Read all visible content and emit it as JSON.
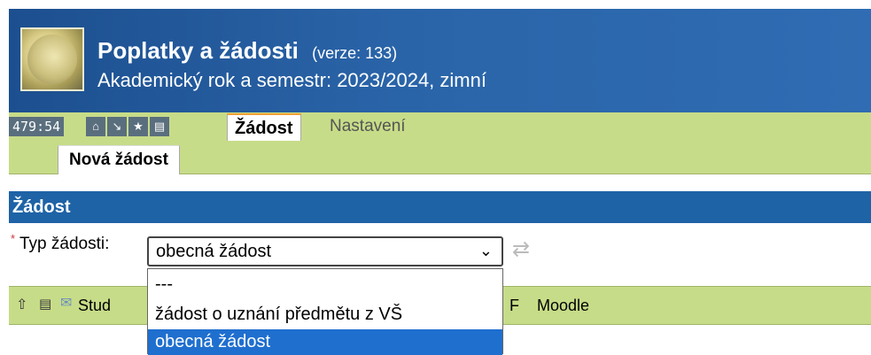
{
  "header": {
    "title": "Poplatky a žádosti",
    "version": "(verze: 133)",
    "subtitle": "Akademický rok a semestr: 2023/2024, zimní"
  },
  "toolbar": {
    "timer": "479:54",
    "icons": [
      "home-icon",
      "arrow-down-right-icon",
      "star-icon",
      "print-icon"
    ],
    "tabs": [
      {
        "label": "Žádost",
        "active": true
      },
      {
        "label": "Nastavení",
        "active": false
      }
    ]
  },
  "subtabs": [
    {
      "label": "Nová žádost",
      "active": true
    }
  ],
  "section": {
    "title": "Žádost"
  },
  "form": {
    "required_mark": "*",
    "type_label": "Typ žádosti:",
    "type_value": "obecná žádost"
  },
  "dropdown": {
    "options": [
      "---",
      "žádost o uznání předmětu z VŠ",
      "obecná žádost"
    ],
    "selected_index": 2
  },
  "footer": {
    "stud": "Stud",
    "f": "F",
    "moodle": "Moodle"
  },
  "colors": {
    "header_blue": "#2a64a8",
    "toolbar_green": "#c7dc88",
    "section_blue": "#1e63a6",
    "selected_option": "#1f6fcf"
  }
}
